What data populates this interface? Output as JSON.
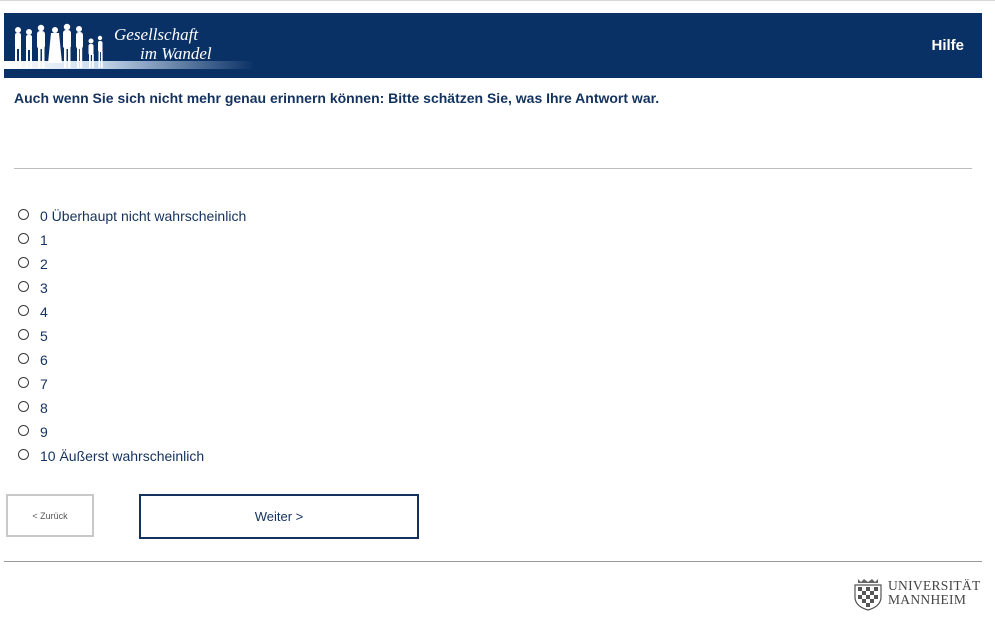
{
  "header": {
    "logo_line1": "Gesellschaft",
    "logo_line2": "im Wandel",
    "help_label": "Hilfe"
  },
  "question": {
    "text": "Auch wenn Sie sich nicht mehr genau erinnern können: Bitte schätzen Sie, was Ihre Antwort war."
  },
  "options": [
    "0 Überhaupt nicht wahrscheinlich",
    "1",
    "2",
    "3",
    "4",
    "5",
    "6",
    "7",
    "8",
    "9",
    "10 Äußerst wahrscheinlich"
  ],
  "nav": {
    "back_label": "< Zurück",
    "next_label": "Weiter >"
  },
  "footer": {
    "uni_line1": "UNIVERSITÄT",
    "uni_line2": "MANNHEIM"
  },
  "colors": {
    "header_bg": "#0a3166",
    "text_primary": "#13325e"
  }
}
